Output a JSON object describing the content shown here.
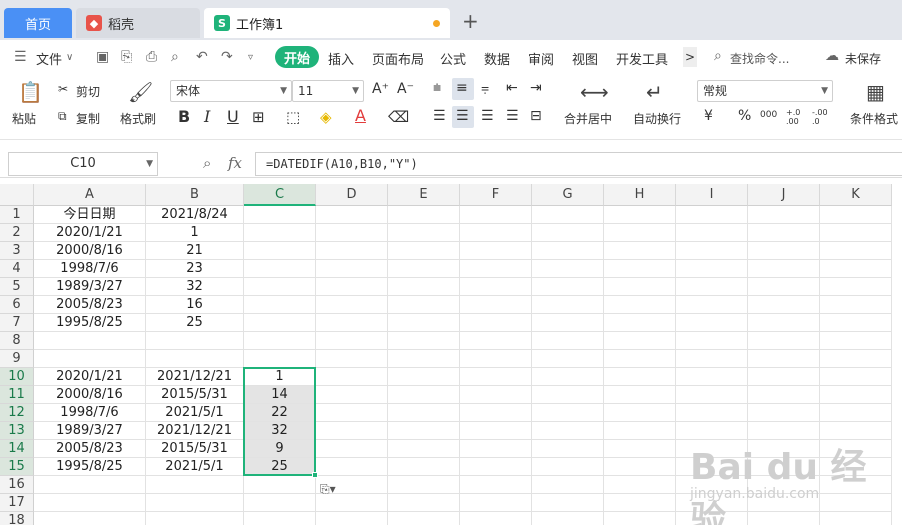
{
  "tabs": {
    "home": "首页",
    "daoke": "稻壳",
    "workbook": "工作簿1",
    "sheet_icon": "S",
    "new_tab": "+"
  },
  "menu": {
    "file": "文件",
    "start": "开始",
    "items": [
      "插入",
      "页面布局",
      "公式",
      "数据",
      "审阅",
      "视图",
      "开发工具"
    ],
    "more": ">",
    "search_placeholder": "查找命令...",
    "unsaved": "未保存"
  },
  "ribbon": {
    "paste": "粘贴",
    "cut": "剪切",
    "copy": "复制",
    "format_painter": "格式刷",
    "font_name": "宋体",
    "font_size": "11",
    "increase_font": "A⁺",
    "decrease_font": "A⁻",
    "bold": "B",
    "italic": "I",
    "underline": "U",
    "merge_center": "合并居中",
    "wrap_text": "自动换行",
    "number_format": "常规",
    "currency": "¥",
    "percent": "%",
    "thousands": "000",
    "inc_decimal": "+.0 .00",
    "dec_decimal": "-.00 .0",
    "conditional_format": "条件格式"
  },
  "formula_bar": {
    "name_box": "C10",
    "fx": "fx",
    "formula": "=DATEDIF(A10,B10,\"Y\")"
  },
  "columns": [
    "A",
    "B",
    "C",
    "D",
    "E",
    "F",
    "G",
    "H",
    "I",
    "J",
    "K"
  ],
  "rows": [
    "1",
    "2",
    "3",
    "4",
    "5",
    "6",
    "7",
    "8",
    "9",
    "10",
    "11",
    "12",
    "13",
    "14",
    "15",
    "16",
    "17",
    "18"
  ],
  "cells": [
    [
      "今日日期",
      "2021/8/24",
      ""
    ],
    [
      "2020/1/21",
      "1",
      ""
    ],
    [
      "2000/8/16",
      "21",
      ""
    ],
    [
      "1998/7/6",
      "23",
      ""
    ],
    [
      "1989/3/27",
      "32",
      ""
    ],
    [
      "2005/8/23",
      "16",
      ""
    ],
    [
      "1995/8/25",
      "25",
      ""
    ],
    [
      "",
      "",
      ""
    ],
    [
      "",
      "",
      ""
    ],
    [
      "2020/1/21",
      "2021/12/21",
      "1"
    ],
    [
      "2000/8/16",
      "2015/5/31",
      "14"
    ],
    [
      "1998/7/6",
      "2021/5/1",
      "22"
    ],
    [
      "1989/3/27",
      "2021/12/21",
      "32"
    ],
    [
      "2005/8/23",
      "2015/5/31",
      "9"
    ],
    [
      "1995/8/25",
      "2021/5/1",
      "25"
    ],
    [
      "",
      "",
      ""
    ],
    [
      "",
      "",
      ""
    ],
    [
      "",
      "",
      ""
    ]
  ],
  "selection": {
    "active_cell": "C10",
    "range": "C10:C15"
  },
  "watermark": {
    "brand": "Bai du 经验",
    "url": "jingyan.baidu.com"
  }
}
